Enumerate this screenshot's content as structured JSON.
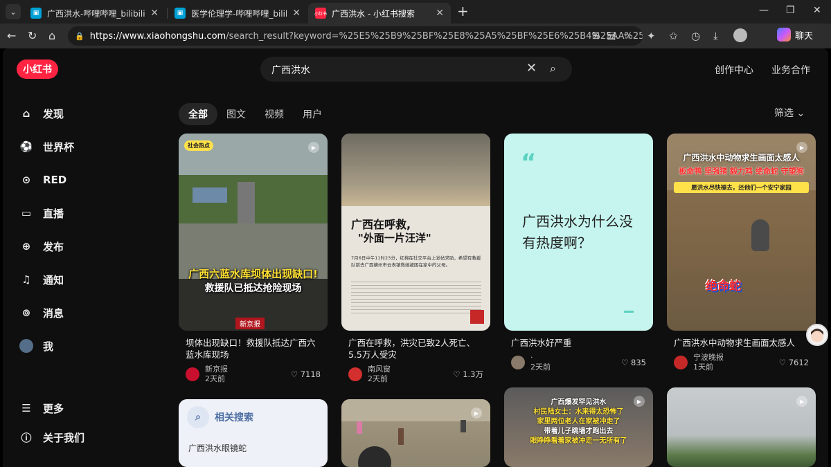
{
  "browser": {
    "tabs": [
      {
        "title": "广西洪水-哔哩哔哩_bilibili",
        "icon": "bilibili-icon",
        "active": false
      },
      {
        "title": "医学伦理学-哔哩哔哩_bilibili",
        "icon": "bilibili-icon",
        "active": false
      },
      {
        "title": "广西洪水 - 小红书搜索",
        "icon": "xiaohongshu-icon",
        "active": true
      }
    ],
    "url_domain": "https://www.xiaohongshu.com",
    "url_path": "/search_result?keyword=%25E5%25B9%25BF%25E8%25A5%25BF%25E6%25B4%25AA%25E6%25B0%2...",
    "copilot_label": "聊天"
  },
  "header": {
    "logo": "小红书",
    "search_value": "广西洪水",
    "links": [
      "创作中心",
      "业务合作"
    ]
  },
  "sidebar": {
    "items": [
      {
        "label": "发现",
        "icon": "home-icon"
      },
      {
        "label": "世界杯",
        "icon": "soccer-ball-icon"
      },
      {
        "label": "RED",
        "icon": "play-circle-icon"
      },
      {
        "label": "直播",
        "icon": "live-icon"
      },
      {
        "label": "发布",
        "icon": "plus-icon"
      },
      {
        "label": "通知",
        "icon": "bell-icon"
      },
      {
        "label": "消息",
        "icon": "chat-icon"
      },
      {
        "label": "我",
        "icon": "avatar"
      }
    ],
    "bottom": [
      {
        "label": "更多",
        "icon": "menu-icon"
      },
      {
        "label": "关于我们",
        "icon": "info-icon"
      }
    ]
  },
  "filters": {
    "tabs": [
      "全部",
      "图文",
      "视频",
      "用户"
    ],
    "active": "全部",
    "filter_label": "筛选"
  },
  "cards": [
    {
      "title": "坝体出现缺口！救援队抵达广西六蓝水库现场",
      "author": "新京报",
      "time": "2天前",
      "likes": "7118",
      "tag": "社会热点",
      "overlay_line1": "广西六蓝水库坝体出现缺口!",
      "overlay_line2": "救援队已抵达抢险现场",
      "brand": "新京报",
      "author_color": "#c8102e"
    },
    {
      "title": "广西在呼救，洪灾已致2人死亡、5.5万人受灾",
      "author": "南风窗",
      "time": "2天前",
      "likes": "1.3万",
      "overlay_line1": "广西在呼救,",
      "overlay_line2": "\"外面一片汪洋\"",
      "body_text": "7月6日中午11时23分，红棉在社交平台上发帖求助，希望有救援队前去广西横州市云表镇救她被困在家中的父母。",
      "author_color": "#d32f2f"
    },
    {
      "title": "广西洪水好严重",
      "author": "·",
      "time": "2天前",
      "likes": "835",
      "big_text": "广西洪水为什么没有热度啊？",
      "author_color": "#8a7a6a"
    },
    {
      "title": "广西洪水中动物求生画面太感人",
      "author": "宁波晚报",
      "time": "1天前",
      "likes": "7612",
      "overlay_line1": "广西洪水中动物求生画面太感人",
      "overlay_line2": "板命鸭 坚强猪 毅力鸡 绝命蛇 守望狗",
      "overlay_line3": "愿洪水尽快褪去，还他们一个安宁家园",
      "sticker": "绝命蛇",
      "author_color": "#c62828"
    }
  ],
  "related": {
    "title": "相关搜索",
    "items": [
      "广西洪水眼镜蛇"
    ]
  },
  "row2_card3": {
    "line1": "广西爆发罕见洪水",
    "line2": "村民陆女士：水来得太恐怖了",
    "line3": "家里两位老人在家被冲走了",
    "line4": "带着儿子跳墙才跑出去",
    "line5": "眼睁睁看着家被冲走一无所有了"
  }
}
